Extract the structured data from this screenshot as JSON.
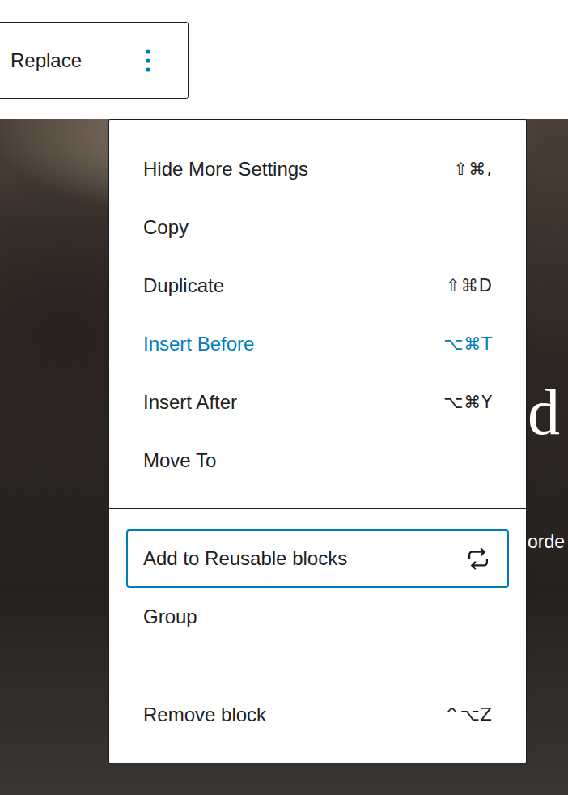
{
  "toolbar": {
    "replace": "Replace"
  },
  "cover": {
    "heading": "d",
    "subtext": "orde"
  },
  "menu": {
    "groups": [
      [
        {
          "label": "Hide More Settings",
          "kind": "shortcut",
          "shortcut": "⇧⌘,",
          "hovered": false,
          "focused": false
        },
        {
          "label": "Copy",
          "kind": "plain",
          "hovered": false,
          "focused": false
        },
        {
          "label": "Duplicate",
          "kind": "shortcut",
          "shortcut": "⇧⌘D",
          "hovered": false,
          "focused": false
        },
        {
          "label": "Insert Before",
          "kind": "shortcut",
          "shortcut": "⌥⌘T",
          "hovered": true,
          "focused": false
        },
        {
          "label": "Insert After",
          "kind": "shortcut",
          "shortcut": "⌥⌘Y",
          "hovered": false,
          "focused": false
        },
        {
          "label": "Move To",
          "kind": "plain",
          "hovered": false,
          "focused": false
        }
      ],
      [
        {
          "label": "Add to Reusable blocks",
          "kind": "icon",
          "hovered": false,
          "focused": true
        },
        {
          "label": "Group",
          "kind": "plain",
          "hovered": false,
          "focused": false
        }
      ],
      [
        {
          "label": "Remove block",
          "kind": "shortcut",
          "shortcut": "^⌥Z",
          "hovered": false,
          "focused": false
        }
      ]
    ]
  }
}
